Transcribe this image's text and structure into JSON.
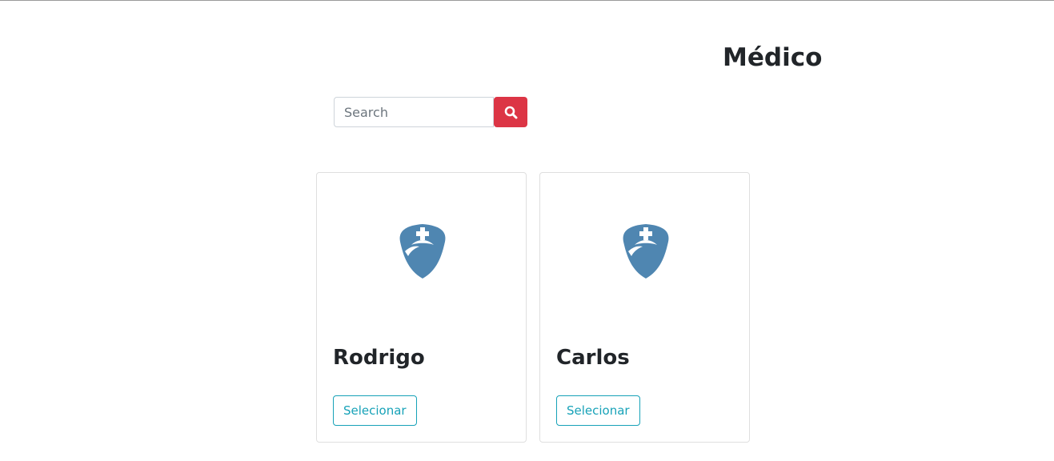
{
  "header": {
    "title": "Médico"
  },
  "search": {
    "placeholder": "Search",
    "value": "",
    "button_icon": "search-icon",
    "button_color": "#dc3545"
  },
  "doctors": [
    {
      "name": "Rodrigo",
      "icon": "doctor-nurse-icon",
      "button_label": "Selecionar"
    },
    {
      "name": "Carlos",
      "icon": "doctor-nurse-icon",
      "button_label": "Selecionar"
    }
  ],
  "colors": {
    "icon": "#4f86b1",
    "accent": "#17a2b8",
    "danger": "#dc3545"
  }
}
